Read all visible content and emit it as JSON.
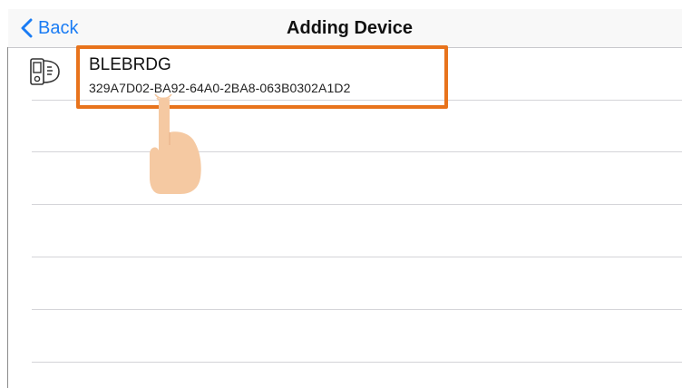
{
  "navbar": {
    "back_label": "Back",
    "title": "Adding Device"
  },
  "devices": [
    {
      "name": "BLEBRDG",
      "uuid": "329A7D02-BA92-64A0-2BA8-063B0302A1D2",
      "icon": "bluetooth-device-icon"
    }
  ],
  "colors": {
    "accent": "#1a7cf4",
    "highlight": "#e8731c",
    "hand": "#f5c9a2"
  },
  "icons": {
    "back": "chevron-left-icon",
    "pointer": "tap-hand-icon"
  }
}
